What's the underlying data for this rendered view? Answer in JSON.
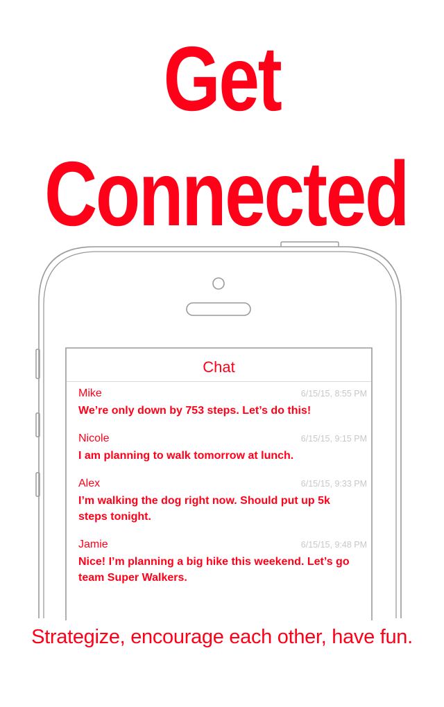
{
  "headline": {
    "line1": "Get",
    "line2": "Connected"
  },
  "chat": {
    "title": "Chat",
    "messages": [
      {
        "name": "Mike",
        "time": "6/15/15, 8:55 PM",
        "text": "We’re only down by 753 steps.  Let’s do this!"
      },
      {
        "name": "Nicole",
        "time": "6/15/15, 9:15 PM",
        "text": "I am planning to walk tomorrow at lunch."
      },
      {
        "name": "Alex",
        "time": "6/15/15, 9:33 PM",
        "text": "I’m walking the dog right now.  Should put up 5k steps tonight."
      },
      {
        "name": "Jamie",
        "time": "6/15/15, 9:48 PM",
        "text": "Nice!  I’m planning a big hike this weekend. Let’s go team Super Walkers."
      }
    ]
  },
  "tagline": "Strategize, encourage each other, have fun.",
  "colors": {
    "accent": "#ff0019",
    "timestamp": "#c8c8c8",
    "outline": "#9a9a9a"
  }
}
